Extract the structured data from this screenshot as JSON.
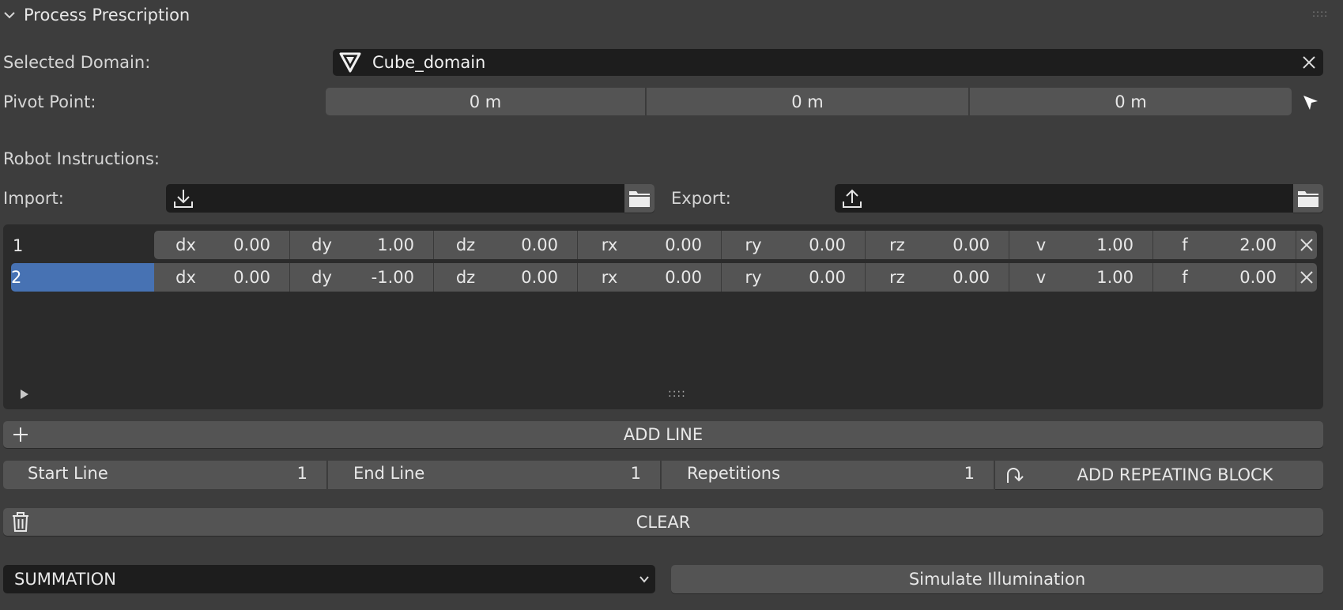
{
  "panel": {
    "title": "Process Prescription"
  },
  "domain": {
    "label": "Selected Domain:",
    "value": "Cube_domain"
  },
  "pivot": {
    "label": "Pivot Point:",
    "x": "0 m",
    "y": "0 m",
    "z": "0 m"
  },
  "robot": {
    "label": "Robot Instructions:"
  },
  "import": {
    "label": "Import:",
    "value": ""
  },
  "export": {
    "label": "Export:",
    "value": ""
  },
  "rows": [
    {
      "index": "1",
      "dx": "0.00",
      "dy": "1.00",
      "dz": "0.00",
      "rx": "0.00",
      "ry": "0.00",
      "rz": "0.00",
      "v": "1.00",
      "f": "2.00"
    },
    {
      "index": "2",
      "dx": "0.00",
      "dy": "-1.00",
      "dz": "0.00",
      "rx": "0.00",
      "ry": "0.00",
      "rz": "0.00",
      "v": "1.00",
      "f": "0.00"
    }
  ],
  "columns": [
    "dx",
    "dy",
    "dz",
    "rx",
    "ry",
    "rz",
    "v",
    "f"
  ],
  "list": {
    "grip": "::::"
  },
  "add_line": {
    "label": "ADD LINE"
  },
  "repeat": {
    "start_label": "Start Line",
    "start_value": "1",
    "end_label": "End Line",
    "end_value": "1",
    "rep_label": "Repetitions",
    "rep_value": "1",
    "button_label": "ADD REPEATING BLOCK"
  },
  "clear": {
    "label": "CLEAR"
  },
  "mode": {
    "value": "SUMMATION"
  },
  "simulate": {
    "label": "Simulate Illumination"
  },
  "colors": {
    "background": "#3d3d3d",
    "field_dark": "#1d1d1d",
    "button": "#545454",
    "selection": "#4772b3"
  },
  "icons": {
    "collapse": "chevron-down-icon",
    "mesh": "mesh-triangle-icon",
    "clear_x": "close-icon",
    "eyedropper": "cursor-arrow-icon",
    "import": "download-icon",
    "export": "upload-icon",
    "folder": "folder-icon",
    "play": "play-icon",
    "add": "plus-icon",
    "loop": "loop-arrow-icon",
    "trash": "trash-icon",
    "dropdown": "chevron-down-icon"
  }
}
